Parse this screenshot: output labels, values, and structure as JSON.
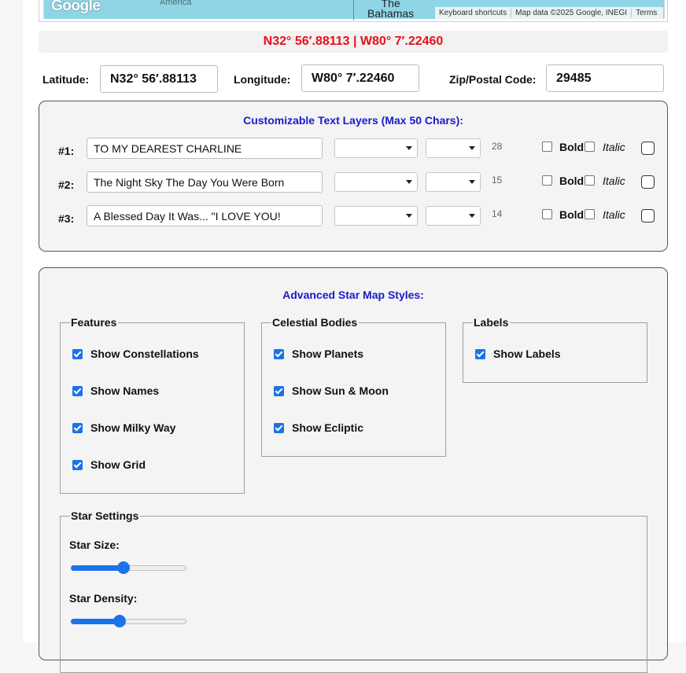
{
  "map": {
    "logo": "Google",
    "label_america": "America",
    "label_bahamas_line1": "The",
    "label_bahamas_line2": "Bahamas",
    "attribution": [
      "Keyboard shortcuts",
      "Map data ©2025 Google, INEGI",
      "Terms"
    ]
  },
  "coordinates_display": "N32° 56′.88113 | W80° 7′.22460",
  "location": {
    "latitude_label": "Latitude:",
    "latitude_value": "N32° 56′.88113",
    "longitude_label": "Longitude:",
    "longitude_value": "W80° 7′.22460",
    "zip_label": "Zip/Postal Code:",
    "zip_value": "29485"
  },
  "text_layers": {
    "title": "Customizable Text Layers (Max 50 Chars):",
    "bold_label": "Bold",
    "italic_label": "Italic",
    "rows": [
      {
        "num": "#1:",
        "text": "TO MY DEAREST CHARLINE",
        "count": "28"
      },
      {
        "num": "#2:",
        "text": "The Night Sky The Day You Were Born",
        "count": "15"
      },
      {
        "num": "#3:",
        "text": "A Blessed Day It Was... \"I LOVE YOU!",
        "count": "14"
      }
    ]
  },
  "advanced": {
    "title": "Advanced Star Map Styles:",
    "features": {
      "legend": "Features",
      "items": [
        "Show Constellations",
        "Show Names",
        "Show Milky Way",
        "Show Grid"
      ]
    },
    "celestial": {
      "legend": "Celestial Bodies",
      "items": [
        "Show Planets",
        "Show Sun & Moon",
        "Show Ecliptic"
      ]
    },
    "labels": {
      "legend": "Labels",
      "items": [
        "Show Labels"
      ]
    },
    "star_settings": {
      "legend": "Star Settings",
      "star_size_label": "Star Size:",
      "star_size_value": 0.45,
      "star_density_label": "Star Density:",
      "star_density_value": 0.41
    }
  },
  "colors": {
    "accent_blue": "#1a73e8",
    "title_blue": "#1a1acc",
    "coord_red": "#e8101a"
  }
}
